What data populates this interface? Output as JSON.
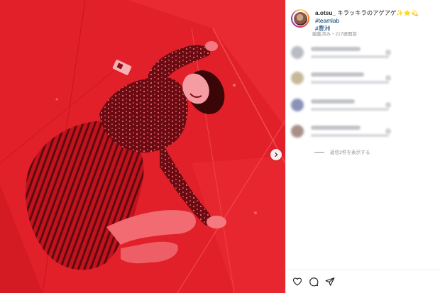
{
  "post": {
    "username": "a.otsu_",
    "caption_text": " キラッキラのアゲアゲ",
    "caption_emoji": "✨⭐💫",
    "hashtag_1": " #teamlab",
    "hashtag_2": "#豊洲",
    "meta": "編集済み・217週間前"
  },
  "comments": {
    "view_replies": "返信2件を表示する"
  },
  "icons": {
    "next": "chevron-right-icon",
    "like": "heart-icon",
    "comment": "comment-icon",
    "share": "paper-plane-icon"
  },
  "colors": {
    "photo_tint": "#e2202a",
    "hashtag": "#00376b",
    "muted": "#8e8e8e"
  }
}
